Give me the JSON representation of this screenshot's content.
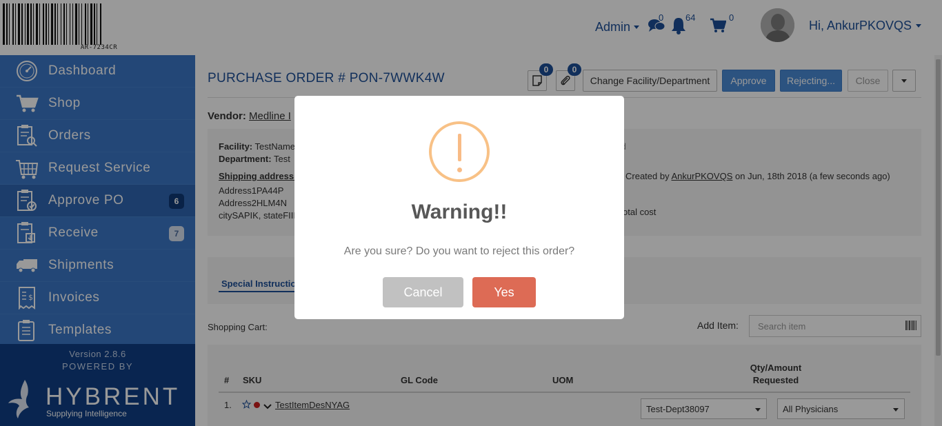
{
  "barcode": {
    "text": "AR-7234CR"
  },
  "sidebar": {
    "items": [
      {
        "label": "Dashboard",
        "icon": "dashboard-icon"
      },
      {
        "label": "Shop",
        "icon": "shopping-cart-icon"
      },
      {
        "label": "Orders",
        "icon": "orders-clipboard-icon"
      },
      {
        "label": "Request Service",
        "icon": "service-cart-icon"
      },
      {
        "label": "Approve PO",
        "icon": "approve-clipboard-icon",
        "badge": "6"
      },
      {
        "label": "Receive",
        "icon": "receive-clipboard-icon",
        "badge": "7"
      },
      {
        "label": "Shipments",
        "icon": "truck-icon"
      },
      {
        "label": "Invoices",
        "icon": "invoice-icon"
      },
      {
        "label": "Templates",
        "icon": "template-icon"
      }
    ],
    "version": "Version 2.8.6",
    "powered_by": "POWERED BY",
    "brand": "HYBRENT",
    "tagline": "Supplying Intelligence"
  },
  "header": {
    "admin_label": "Admin",
    "messages_count": "0",
    "notifications_count": "64",
    "cart_count": "0",
    "greeting": "Hi, AnkurPKOVQS"
  },
  "po": {
    "title": "PURCHASE ORDER # PON-7WWK4W",
    "notes_badge": "0",
    "attachments_badge": "0",
    "buttons": {
      "change_facility": "Change Facility/Department",
      "approve": "Approve",
      "rejecting": "Rejecting...",
      "close": "Close"
    },
    "vendor_label": "Vendor:",
    "vendor_name": "Medline I",
    "facility_label": "Facility:",
    "facility_value": "TestName",
    "department_label": "Department:",
    "department_value": "Test",
    "shipping_label": "Shipping address:",
    "address1": "Address1PA44P",
    "address2": "Address2HLM4N",
    "city_line": "citySAPIK, stateFIII",
    "status_fragment": "ved",
    "created_prefix": "Created by",
    "created_by": "AnkurPKOVQS",
    "created_suffix": "on Jun, 18th 2018 (a few seconds ago)",
    "total_cost_fragment": "otal cost",
    "tab_special": "Special Instructio"
  },
  "cart": {
    "label": "Shopping Cart:",
    "add_item_label": "Add Item:",
    "search_placeholder": "Search item",
    "columns": {
      "num": "#",
      "sku": "SKU",
      "gl_code": "GL Code",
      "uom": "UOM",
      "qty_line1": "Qty/Amount",
      "qty_line2": "Requested"
    },
    "rows": [
      {
        "num": "1.",
        "item": "TestItemDesNYAG",
        "department": "Test-Dept38097",
        "physician": "All Physicians"
      }
    ]
  },
  "modal": {
    "title": "Warning!!",
    "text": "Are you sure? Do you want to reject this order?",
    "cancel": "Cancel",
    "confirm": "Yes"
  },
  "colors": {
    "sidebar": "#3b77c6",
    "brand_blue": "#1d4f98",
    "primary_button": "#4a8ad6",
    "warning": "#f8bb86",
    "confirm_button": "#dd6b55",
    "cancel_button": "#c1c1c1"
  }
}
